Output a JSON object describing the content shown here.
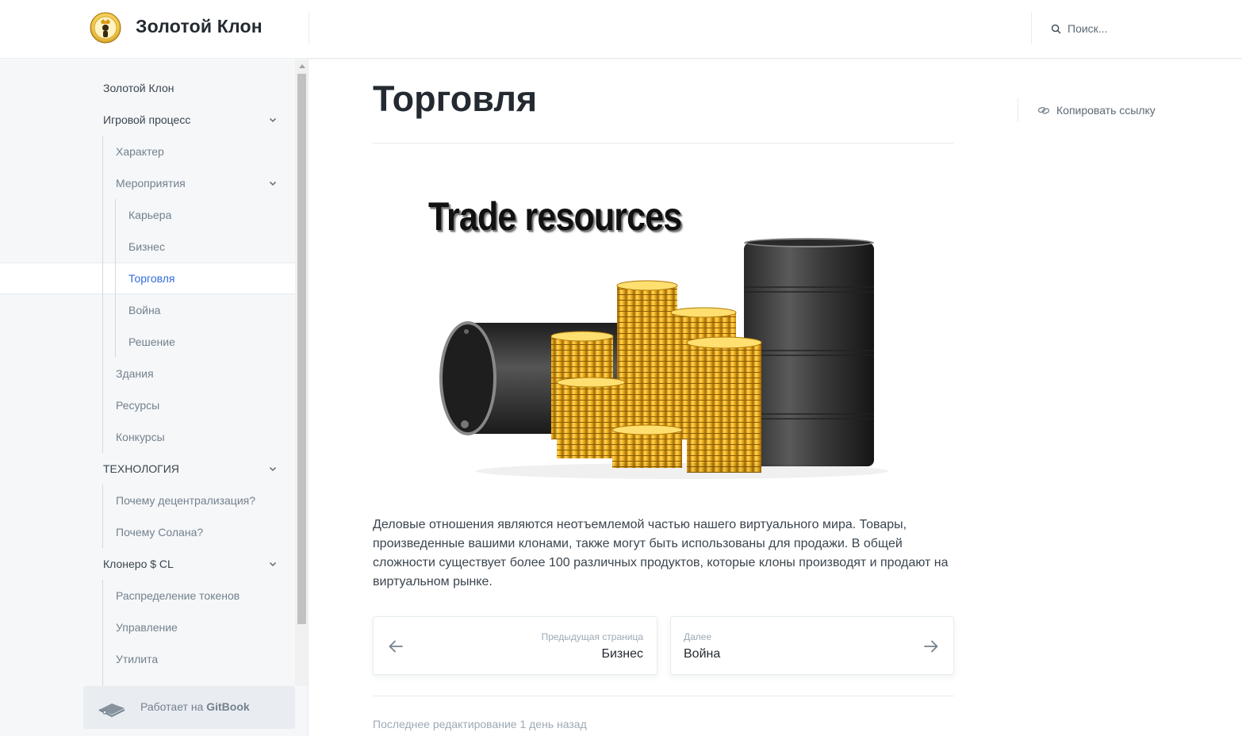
{
  "header": {
    "site_title": "Золотой Клон",
    "search_placeholder": "Поиск..."
  },
  "sidebar": {
    "items": [
      {
        "label": "Золотой Клон",
        "level": 0
      },
      {
        "label": "Игровой процесс",
        "level": 0,
        "expanded": true
      },
      {
        "label": "Характер",
        "level": 1
      },
      {
        "label": "Мероприятия",
        "level": 1,
        "expanded": true
      },
      {
        "label": "Карьера",
        "level": 2
      },
      {
        "label": "Бизнес",
        "level": 2
      },
      {
        "label": "Торговля",
        "level": 2,
        "active": true
      },
      {
        "label": "Война",
        "level": 2
      },
      {
        "label": "Решение",
        "level": 2
      },
      {
        "label": "Здания",
        "level": 1
      },
      {
        "label": "Ресурсы",
        "level": 1
      },
      {
        "label": "Конкурсы",
        "level": 1
      },
      {
        "label": "ТЕХНОЛОГИЯ",
        "level": 0,
        "expanded": true
      },
      {
        "label": "Почему децентрализация?",
        "level": 1
      },
      {
        "label": "Почему Солана?",
        "level": 1
      },
      {
        "label": "Клонеро $ CL",
        "level": 0,
        "expanded": true
      },
      {
        "label": "Распределение токенов",
        "level": 1
      },
      {
        "label": "Управление",
        "level": 1
      },
      {
        "label": "Утилита",
        "level": 1
      }
    ],
    "powered_prefix": "Работает на",
    "powered_brand": "GitBook"
  },
  "main": {
    "title": "Торговля",
    "copy_link": "Копировать ссылку",
    "hero_caption": "Trade resources",
    "body": "Деловые отношения являются неотъемлемой частью нашего виртуального мира. Товары, произведенные вашими клонами, также могут быть использованы для продажи. В общей сложности существует более 100 различных продуктов, которые клоны производят и продают на виртуальном рынке.",
    "prev": {
      "caption": "Предыдущая страница",
      "title": "Бизнес"
    },
    "next": {
      "caption": "Далее",
      "title": "Война"
    },
    "last_edited": "Последнее редактирование 1 день назад"
  },
  "colors": {
    "accent": "#346ddb",
    "sidebar_bg": "#f5f7f9",
    "text": "#3b454e",
    "gold": "#e8a920"
  }
}
